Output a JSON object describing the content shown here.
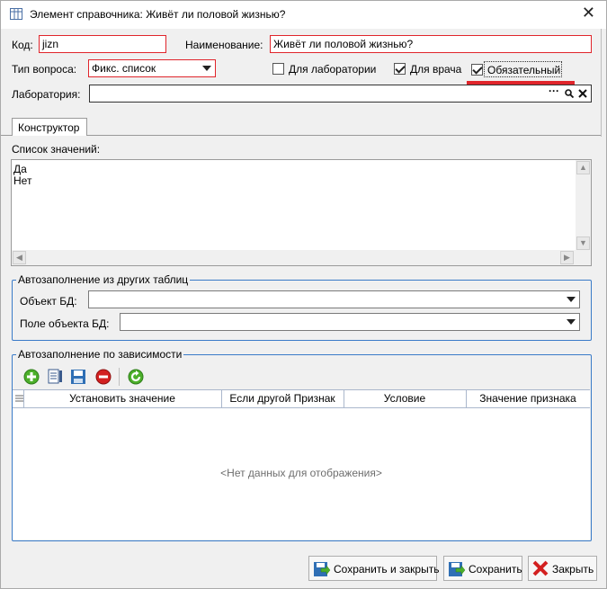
{
  "window": {
    "title": "Элемент справочника: Живёт ли половой жизнью?",
    "close_glyph": "✕"
  },
  "form": {
    "code_label": "Код:",
    "code_value": "jizn",
    "name_label": "Наименование:",
    "name_value": "Живёт ли половой жизнью?",
    "type_label": "Тип вопроса:",
    "type_value": "Фикс. список",
    "lab_check_label": "Для лаборатории",
    "lab_check_checked": false,
    "doctor_check_label": "Для врача",
    "doctor_check_checked": true,
    "required_check_label": "Обязательный",
    "required_check_checked": true,
    "laboratory_label": "Лаборатория:",
    "laboratory_value": "",
    "laboratory_buttons": [
      "···",
      "search-icon",
      "clear-icon"
    ]
  },
  "tabs": [
    {
      "label": "Конструктор",
      "active": true
    }
  ],
  "constructor": {
    "values_label": "Список значений:",
    "values": [
      "Да",
      "Нет"
    ],
    "autofill_tables": {
      "title": "Автозаполнение из других таблиц",
      "db_object_label": "Объект БД:",
      "db_object_value": "",
      "db_field_label": "Поле объекта БД:",
      "db_field_value": ""
    },
    "autofill_dependency": {
      "title": "Автозаполнение по зависимости",
      "toolbar_icons": [
        "add-icon",
        "edit-icon",
        "save-icon",
        "delete-icon",
        "refresh-icon"
      ],
      "columns": [
        "Установить значение",
        "Если другой Признак",
        "Условие",
        "Значение признака"
      ],
      "rows": [],
      "empty_text": "<Нет данных для отображения>"
    }
  },
  "footer": {
    "save_close_label": "Сохранить и закрыть",
    "save_label": "Сохранить",
    "close_label": "Закрыть"
  },
  "colors": {
    "required_border": "#e0252b",
    "group_border": "#3a7bc8",
    "underline_annotation": "#e0252b"
  }
}
